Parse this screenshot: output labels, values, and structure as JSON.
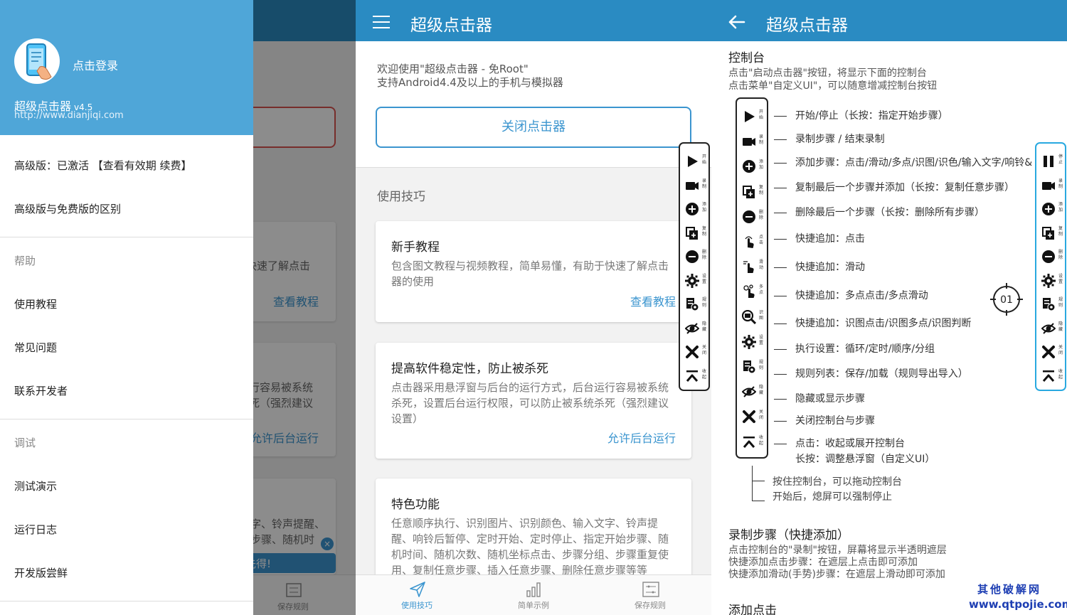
{
  "drawer": {
    "login": "点击登录",
    "app_name": "超级点击器",
    "version": "v4.5",
    "url": "http://www.dianjiqi.com",
    "premium": "高级版：已激活 【查看有效期 续费】",
    "compare": "高级版与免费版的区别",
    "help_section": "帮助",
    "help_items": [
      "使用教程",
      "常见问题",
      "联系开发者"
    ],
    "debug_section": "调试",
    "debug_items": [
      "测试演示",
      "运行日志",
      "开发版尝鲜"
    ]
  },
  "background": {
    "card1_text": "快速了解点击",
    "card1_link": "查看教程",
    "card2_line1": "行容易被系统",
    "card2_line2": "死（强烈建议",
    "card2_link": "允许后台运行",
    "card3_line1": "字、铃声提醒、",
    "card3_line2": "步骤、随机时",
    "banner": "别先得!",
    "banner_close": "×",
    "nav_label": "保存规则"
  },
  "main": {
    "title": "超级点击器",
    "welcome_line1": "欢迎使用\"超级点击器 - 免Root\"",
    "welcome_line2": "支持Android4.4及以上的手机与模拟器",
    "close_button": "关闭点击器",
    "tips_label": "使用技巧",
    "cards": [
      {
        "title": "新手教程",
        "body": "包含图文教程与视频教程，简单易懂，有助于快速了解点击器的使用",
        "link": "查看教程"
      },
      {
        "title": "提高软件稳定性，防止被杀死",
        "body": "点击器采用悬浮窗与后台的运行方式，后台运行容易被系统杀死，设置后台运行权限，可以防止被系统杀死（强烈建议设置）",
        "link": "允许后台运行"
      },
      {
        "title": "特色功能",
        "body": "任意顺序执行、识别图片、识别颜色、输入文字、铃声提醒、响铃后暂停、定时开始、定时停止、指定开始步骤、随机时间、随机次数、随机坐标点击、步骤分组、步骤重复使用、复制任意步骤、插入任意步骤、删除任意步骤等等",
        "link": ""
      }
    ],
    "nav": [
      "使用技巧",
      "简单示例",
      "保存规则"
    ]
  },
  "toolbar": {
    "labels": [
      "开始",
      "录制",
      "添加",
      "复制",
      "删除",
      "设置",
      "规则",
      "隐藏",
      "关闭",
      "收起"
    ],
    "pause_label": "停止",
    "labels_p3": [
      "开始",
      "录制",
      "添加",
      "复制",
      "删除",
      "点击",
      "滑动",
      "多点",
      "识图",
      "设置",
      "规则",
      "隐藏",
      "关闭",
      "收起"
    ]
  },
  "help": {
    "title": "超级点击器",
    "console_heading": "控制台",
    "console_line1": "点击\"启动点击器\"按钮，将显示下面的控制台",
    "console_line2": "点击菜单\"自定义UI\"，可以随意增减控制台按钮",
    "legend": [
      "开始/停止（长按：指定开始步骤）",
      "录制步骤 / 结束录制",
      "添加步骤：点击/滑动/多点/识图/识色/输入文字/响铃&",
      "复制最后一个步骤并添加（长按：复制任意步骤）",
      "删除最后一个步骤（长按：删除所有步骤）",
      "快捷追加：点击",
      "快捷追加：滑动",
      "快捷追加：多点点击/多点滑动",
      "快捷追加：识图点击/识图多点/识图判断",
      "执行设置：循环/定时/顺序/分组",
      "规则列表：保存/加载（规则导出导入）",
      "隐藏或显示步骤",
      "关闭控制台与步骤",
      "点击：收起或展开控制台",
      "长按：调整悬浮窗（自定义UI）"
    ],
    "drag_line1": "按住控制台，可以拖动控制台",
    "drag_line2": "开始后，熄屏可以强制停止",
    "record_heading": "录制步骤（快捷添加）",
    "record_line1": "点击控制台的\"录制\"按钮，屏幕将显示半透明遮层",
    "record_line2": "快捷添加点击步骤：在遮层上点击即可添加",
    "record_line3": "快捷添加滑动(手势)步骤：在遮层上滑动即可添加",
    "click_heading": "添加点击",
    "target_label": "01"
  },
  "watermark": {
    "line1": "其他破解网",
    "line2": "www.qtpojie.com"
  },
  "colors": {
    "appbar": "#2a8bc2",
    "drawer_header": "#4fa6d8",
    "accent": "#3b95cf",
    "toolbar_blue": "#29a9e0",
    "watermark": "#1d3eb3"
  }
}
